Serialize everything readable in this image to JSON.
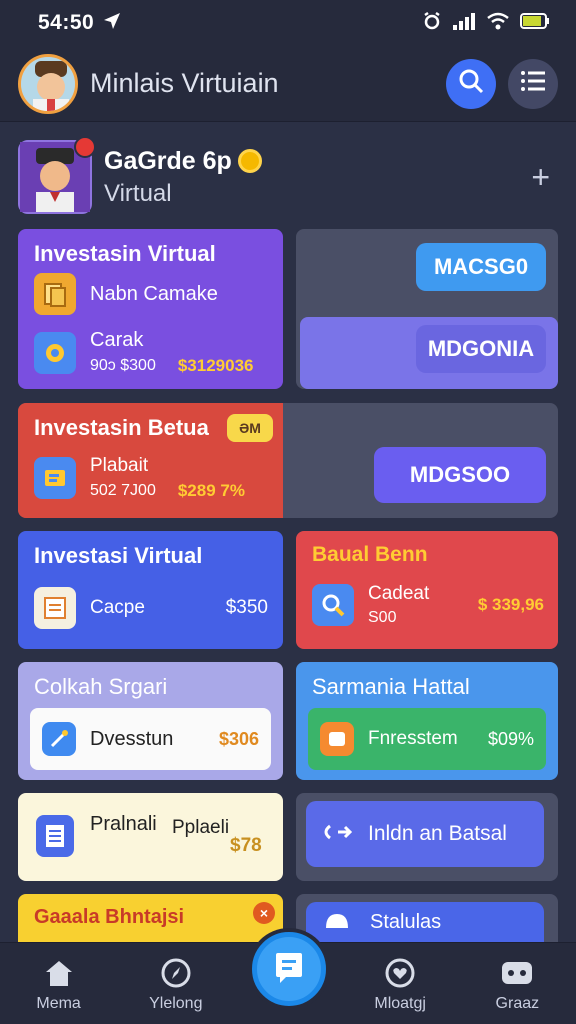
{
  "status": {
    "time": "54:50"
  },
  "header": {
    "title": "Minlais Virtuiain"
  },
  "profile": {
    "name": "GaGrde 6p",
    "subtitle": "Virtual"
  },
  "cards": {
    "c1": {
      "title": "Investasin Virtual",
      "item1": "Nabn Camake",
      "item2_label": "Carak",
      "item2_sub": "90ɔ $300",
      "item2_value": "$3129036"
    },
    "r1": {
      "top_button": "MACSG0",
      "bottom_button": "MDGONIA"
    },
    "c2": {
      "title": "Investasin Betua",
      "badge": "ƏM",
      "item_label": "Plabait",
      "item_sub": "502 7J00",
      "item_value": "$289 7%"
    },
    "r2": {
      "button": "MDGSOO"
    },
    "c3": {
      "title": "Investasi Virtual",
      "item_label": "Cacpe",
      "item_value": "$350"
    },
    "c4": {
      "title": "Baual Benn",
      "item_label": "Cadeat",
      "item_sub": "S00",
      "item_value": "$ 339,96"
    },
    "c5": {
      "title": "Colkah Srgari",
      "item_label": "Dvesstun",
      "item_value": "$306"
    },
    "c6": {
      "title": "Sarmania Hattal",
      "item_label": "Fnresstem",
      "item_value": "$09%"
    },
    "c7": {
      "label1": "Pralnali",
      "label2": "Pplaeli",
      "value": "$78"
    },
    "c8": {
      "label": "Inldn an Batsal"
    },
    "c9": {
      "title": "Gaaala Bhntajsi"
    },
    "c10": {
      "label": "Stalulas"
    }
  },
  "nav": {
    "home": "Mema",
    "explore": "Ylelong",
    "portfolio": "Mloatgj",
    "profile": "Graaz"
  },
  "colors": {
    "bg": "#2b3045",
    "purple": "#7a4fe0",
    "red": "#d8493e",
    "blue": "#4560e6",
    "accent": "#3aa0f5"
  }
}
